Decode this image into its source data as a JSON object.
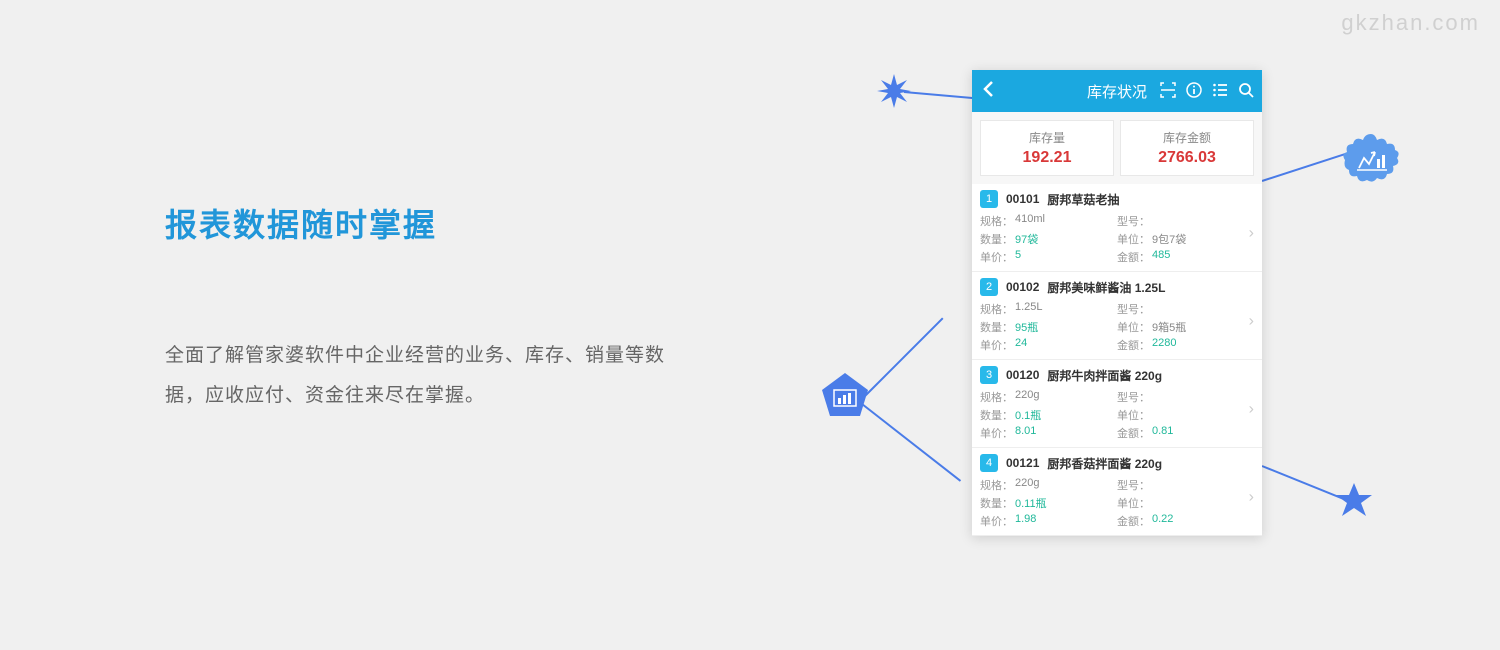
{
  "watermark": "gkzhan.com",
  "left": {
    "heading": "报表数据随时掌握",
    "body": "全面了解管家婆软件中企业经营的业务、库存、销量等数据，应收应付、资金往来尽在掌握。"
  },
  "phone": {
    "header_title": "库存状况",
    "stats": [
      {
        "label": "库存量",
        "value": "192.21"
      },
      {
        "label": "库存金额",
        "value": "2766.03"
      }
    ],
    "labels": {
      "spec": "规格：",
      "model": "型号：",
      "qty": "数量：",
      "unit": "单位：",
      "price": "单价：",
      "amount": "金额："
    },
    "items": [
      {
        "num": "1",
        "code": "00101",
        "name": "厨邦草菇老抽",
        "spec": "410ml",
        "model": "",
        "qty": "97袋",
        "unit": "9包7袋",
        "price": "5",
        "amount": "485"
      },
      {
        "num": "2",
        "code": "00102",
        "name": "厨邦美味鲜酱油 1.25L",
        "spec": "1.25L",
        "model": "",
        "qty": "95瓶",
        "unit": "9箱5瓶",
        "price": "24",
        "amount": "2280"
      },
      {
        "num": "3",
        "code": "00120",
        "name": "厨邦牛肉拌面酱 220g",
        "spec": "220g",
        "model": "",
        "qty": "0.1瓶",
        "unit": "",
        "price": "8.01",
        "amount": "0.81"
      },
      {
        "num": "4",
        "code": "00121",
        "name": "厨邦香菇拌面酱 220g",
        "spec": "220g",
        "model": "",
        "qty": "0.11瓶",
        "unit": "",
        "price": "1.98",
        "amount": "0.22"
      }
    ]
  }
}
